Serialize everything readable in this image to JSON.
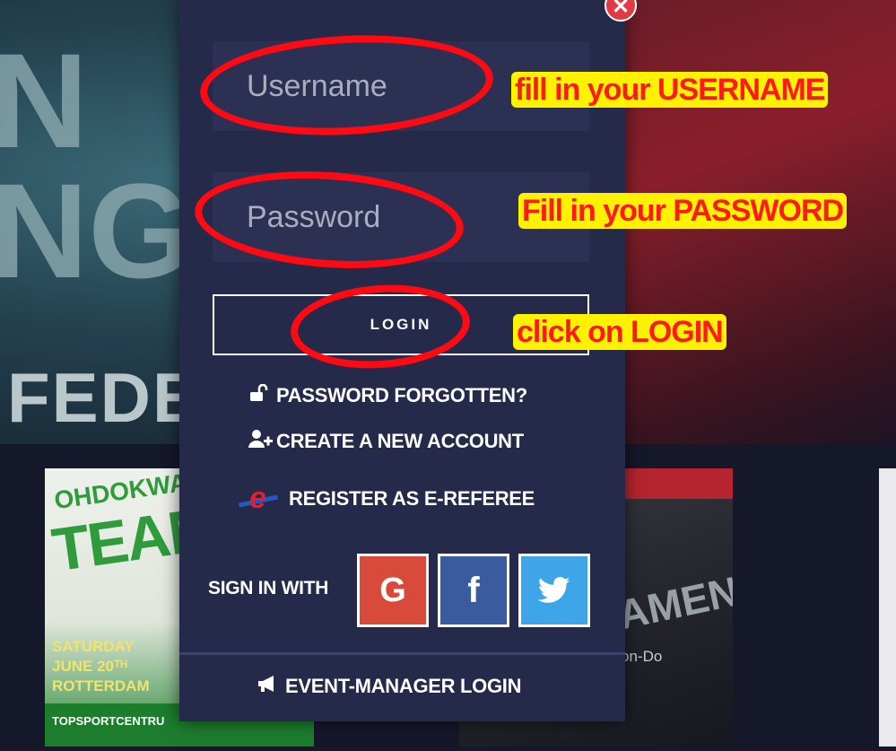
{
  "modal": {
    "close_label": "✕",
    "username_placeholder": "Username",
    "password_placeholder": "Password",
    "login_label": "LOGIN",
    "forgot_label": "PASSWORD FORGOTTEN?",
    "create_label": "CREATE A NEW ACCOUNT",
    "referee_label": "REGISTER AS E-REFEREE",
    "signin_with_label": "SIGN IN WITH",
    "social": [
      {
        "name": "google",
        "glyph": "G",
        "color": "#d84a3a"
      },
      {
        "name": "facebook",
        "glyph": "f",
        "color": "#3a5ba0"
      },
      {
        "name": "twitter",
        "glyph": "twitter-bird",
        "color": "#3ea6e8"
      }
    ],
    "event_manager_label": "EVENT-MANAGER LOGIN"
  },
  "annotations": {
    "username_note": "fill in your USERNAME",
    "password_note": "Fill in your PASSWORD",
    "login_note": "click on LOGIN",
    "highlight_color": "#fff200",
    "text_color": "#ff1a1a"
  },
  "background": {
    "big_letters": "N\nNG",
    "fede_text": "FEDE",
    "left_card": {
      "top_text": "OHDOKWA",
      "team_text": "TEAM",
      "date_lines": [
        "SATURDAY",
        "JUNE 20ᵀᴴ",
        "ROTTERDAM"
      ],
      "footer_text": "TOPSPORTCENTRU"
    },
    "mid_card": {
      "title_text": "AMENT",
      "subtitle_text": "on-Do"
    }
  }
}
